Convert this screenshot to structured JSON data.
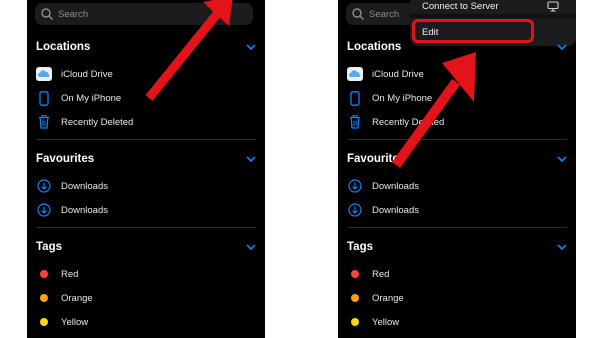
{
  "left": {
    "search": {
      "placeholder": "Search"
    },
    "locations": {
      "header": "Locations",
      "items": [
        {
          "label": "iCloud Drive",
          "icon": "cloud-icon"
        },
        {
          "label": "On My iPhone",
          "icon": "phone-icon"
        },
        {
          "label": "Recently Deleted",
          "icon": "trash-icon"
        }
      ]
    },
    "favourites": {
      "header": "Favourites",
      "items": [
        {
          "label": "Downloads",
          "icon": "download-icon"
        },
        {
          "label": "Downloads",
          "icon": "download-icon"
        }
      ]
    },
    "tags": {
      "header": "Tags",
      "items": [
        {
          "label": "Red",
          "color": "#ff453a"
        },
        {
          "label": "Orange",
          "color": "#ff9f0a"
        },
        {
          "label": "Yellow",
          "color": "#ffd60a"
        }
      ]
    }
  },
  "right": {
    "search": {
      "placeholder": "Search"
    },
    "menu": {
      "connect_label": "Connect to Server",
      "connect_icon": "monitor-icon",
      "edit_label": "Edit"
    },
    "locations": {
      "header": "Locations",
      "items": [
        {
          "label": "iCloud Drive",
          "icon": "cloud-icon"
        },
        {
          "label": "On My iPhone",
          "icon": "phone-icon"
        },
        {
          "label": "Recently Deleted",
          "icon": "trash-icon"
        }
      ]
    },
    "favourites": {
      "header": "Favourites",
      "items": [
        {
          "label": "Downloads",
          "icon": "download-icon"
        },
        {
          "label": "Downloads",
          "icon": "download-icon"
        }
      ]
    },
    "tags": {
      "header": "Tags",
      "items": [
        {
          "label": "Red",
          "color": "#ff453a"
        },
        {
          "label": "Orange",
          "color": "#ff9f0a"
        },
        {
          "label": "Yellow",
          "color": "#ffd60a"
        }
      ]
    }
  },
  "colors": {
    "accent": "#0a84ff",
    "annotation_red": "#e2141a",
    "background": "#000000"
  }
}
